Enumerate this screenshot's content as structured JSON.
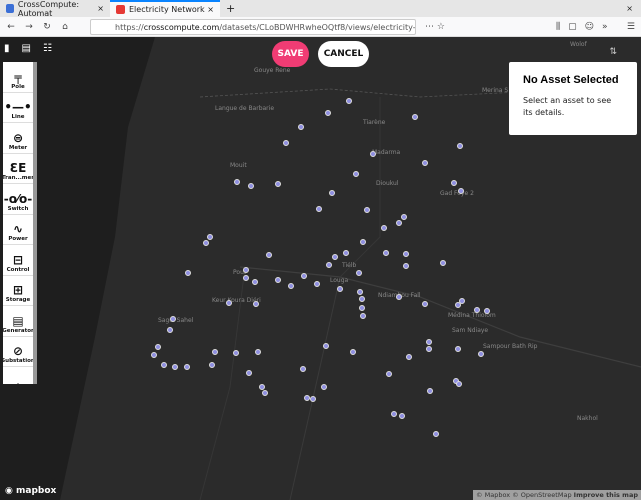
{
  "browser": {
    "tabs": [
      {
        "label": "CrossCompute: Automat",
        "active": false
      },
      {
        "label": "Electricity Network",
        "active": true
      }
    ],
    "new_tab": "+",
    "close_window": "×",
    "url_prefix": "https://",
    "url_domain": "crosscompute.com",
    "url_path": "/datasets/CLoBDWHRwheOQtf8/views/electricity-network#ca0"
  },
  "toolbar": {
    "save_label": "SAVE",
    "cancel_label": "CANCEL"
  },
  "view_buttons": [
    "map-icon",
    "document-icon",
    "list-icon"
  ],
  "palette": {
    "items": [
      {
        "label": "Pole",
        "icon": "pole-icon",
        "glyph": "╤",
        "color": ""
      },
      {
        "label": "Line",
        "icon": "line-icon",
        "glyph": "•—•",
        "color": ""
      },
      {
        "label": "Meter",
        "icon": "meter-icon",
        "glyph": "⊜",
        "color": "#7c4dff"
      },
      {
        "label": "Tran...mer",
        "icon": "transformer-icon",
        "glyph": "ƐE",
        "color": "#d81b60"
      },
      {
        "label": "Switch",
        "icon": "switch-icon",
        "glyph": "-o⁄o-",
        "color": "#00897b"
      },
      {
        "label": "Power",
        "icon": "power-icon",
        "glyph": "∿",
        "color": "#039be5"
      },
      {
        "label": "Control",
        "icon": "control-icon",
        "glyph": "⊟",
        "color": "#6a1b9a"
      },
      {
        "label": "Storage",
        "icon": "storage-icon",
        "glyph": "⊞",
        "color": "#43a047"
      },
      {
        "label": "Generator",
        "icon": "generator-icon",
        "glyph": "▤",
        "color": "#fbc02d"
      },
      {
        "label": "Substation",
        "icon": "substation-icon",
        "glyph": "⊘",
        "color": ""
      },
      {
        "label": "",
        "icon": "station-icon",
        "glyph": "♙",
        "color": ""
      }
    ]
  },
  "details_panel": {
    "title": "No Asset Selected",
    "message": "Select an asset to see its details."
  },
  "map": {
    "labels": [
      "Gouye Rene",
      "Langue de Barbarie",
      "Merina S",
      "Tiarène",
      "Madarma",
      "Mouit",
      "Dioukul",
      "Gad Foye 2",
      "Tiélb",
      "Pout",
      "Louga",
      "Ndiambou Fall",
      "Keur Koura Diéri",
      "Médina Thiolom",
      "Sagui Sahel",
      "Sam Ndiaye",
      "Sampour Bath Rip",
      "Nakhol",
      "Wolof"
    ],
    "attribution": {
      "mapbox": "© Mapbox",
      "osm": "© OpenStreetMap",
      "improve": "Improve this map"
    },
    "logo": "mapbox",
    "marker_color": "#8f8fe0"
  }
}
